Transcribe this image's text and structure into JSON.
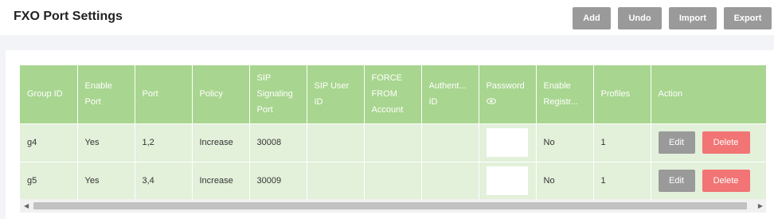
{
  "header": {
    "title": "FXO Port Settings",
    "buttons": {
      "add": "Add",
      "undo": "Undo",
      "import": "Import",
      "export": "Export"
    }
  },
  "table": {
    "columns": [
      "Group ID",
      "Enable Port",
      "Port",
      "Policy",
      "SIP Signaling Port",
      "SIP User ID",
      "FORCE FROM Account",
      "Authent...ID",
      "Password",
      "Enable Registr...",
      "Profiles",
      "Action"
    ],
    "column_parts": {
      "enable_port": [
        "Enable",
        "Port"
      ],
      "sip_signaling_port": [
        "SIP",
        "Signaling",
        "Port"
      ],
      "sip_user_id": [
        "SIP User",
        "ID"
      ],
      "force_from_account": [
        "FORCE",
        "FROM",
        "Account"
      ],
      "authentication_id": [
        "Authent...",
        "ID"
      ],
      "enable_registration": [
        "Enable",
        "Registr..."
      ]
    },
    "rows": [
      {
        "group_id": "g4",
        "enable_port": "Yes",
        "port": "1,2",
        "policy": "Increase",
        "sip_signaling_port": "30008",
        "sip_user_id": "",
        "force_from_account": "",
        "authentication_id": "",
        "password": "",
        "enable_registration": "No",
        "profiles": "1"
      },
      {
        "group_id": "g5",
        "enable_port": "Yes",
        "port": "3,4",
        "policy": "Increase",
        "sip_signaling_port": "30009",
        "sip_user_id": "",
        "force_from_account": "",
        "authentication_id": "",
        "password": "",
        "enable_registration": "No",
        "profiles": "1"
      }
    ],
    "actions": {
      "edit": "Edit",
      "delete": "Delete"
    }
  },
  "icons": {
    "password_toggle": "eye-icon",
    "scroll_left": "arrow-left-icon",
    "scroll_right": "arrow-right-icon"
  },
  "colors": {
    "header_green": "#a8d58f",
    "row_green": "#e3f0da",
    "button_gray": "#9a9a9a",
    "delete_red": "#f27474"
  }
}
